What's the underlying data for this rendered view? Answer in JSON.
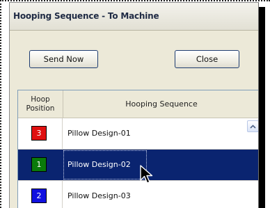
{
  "dialog": {
    "title": "Hooping Sequence - To Machine"
  },
  "buttons": {
    "send_now": "Send Now",
    "close": "Close"
  },
  "grid": {
    "columns": {
      "position": "Hoop\nPosition",
      "sequence": "Hooping Sequence"
    },
    "rows": [
      {
        "position": "3",
        "color": "#e01010",
        "name": "Pillow Design-01",
        "selected": false
      },
      {
        "position": "1",
        "color": "#0a7a0a",
        "name": "Pillow Design-02",
        "selected": true
      },
      {
        "position": "2",
        "color": "#1010e0",
        "name": "Pillow Design-03",
        "selected": false
      }
    ],
    "scrollbar_icon": "scroll-up-arrow-icon"
  },
  "cursor_icon": "mouse-pointer-icon",
  "colors": {
    "selection": "#0a2470",
    "dialog_bg": "#ece9d8"
  }
}
